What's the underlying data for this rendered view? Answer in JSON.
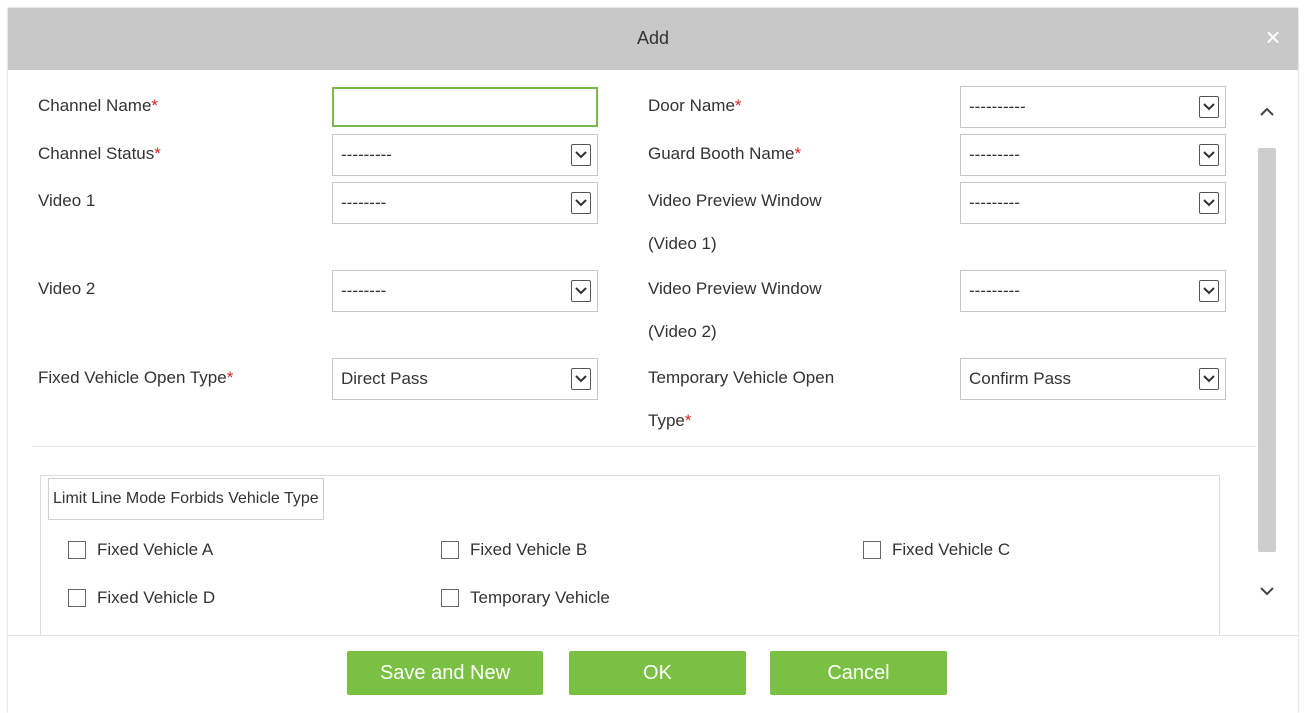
{
  "dialog": {
    "title": "Add",
    "close_label": "×"
  },
  "form": {
    "channel_name": {
      "label": "Channel Name",
      "required_mark": "*",
      "value": ""
    },
    "door_name": {
      "label": "Door Name",
      "required_mark": "*",
      "value": "----------"
    },
    "channel_status": {
      "label": "Channel Status",
      "required_mark": "*",
      "value": "---------"
    },
    "guard_booth_name": {
      "label": "Guard Booth Name",
      "required_mark": "*",
      "value": "---------"
    },
    "video1": {
      "label": "Video 1",
      "value": "--------"
    },
    "video_preview1": {
      "label_line1": "Video Preview Window",
      "label_line2": "(Video 1)",
      "value": "---------"
    },
    "video2": {
      "label": "Video 2",
      "value": "--------"
    },
    "video_preview2": {
      "label_line1": "Video Preview Window",
      "label_line2": "(Video 2)",
      "value": "---------"
    },
    "fixed_open_type": {
      "label": "Fixed Vehicle Open Type",
      "required_mark": "*",
      "value": "Direct Pass"
    },
    "temp_open_type": {
      "label_line1": "Temporary Vehicle Open",
      "label_line2": "Type",
      "required_mark": "*",
      "value": "Confirm Pass"
    }
  },
  "limit_section": {
    "legend": "Limit Line Mode Forbids Vehicle Type",
    "checkboxes": [
      {
        "label": "Fixed Vehicle A",
        "checked": false
      },
      {
        "label": "Fixed Vehicle B",
        "checked": false
      },
      {
        "label": "Fixed Vehicle C",
        "checked": false
      },
      {
        "label": "Fixed Vehicle D",
        "checked": false
      },
      {
        "label": "Temporary Vehicle",
        "checked": false
      }
    ]
  },
  "buttons": {
    "save_new": "Save and New",
    "ok": "OK",
    "cancel": "Cancel"
  },
  "colors": {
    "accent_green": "#7ac143",
    "title_bar": "#c8c8c8",
    "required_red": "#e0241b"
  },
  "icons": {
    "dropdown": "chevron-down-icon",
    "close": "close-icon",
    "scroll_up": "chevron-up-icon",
    "scroll_down": "chevron-down-icon"
  }
}
